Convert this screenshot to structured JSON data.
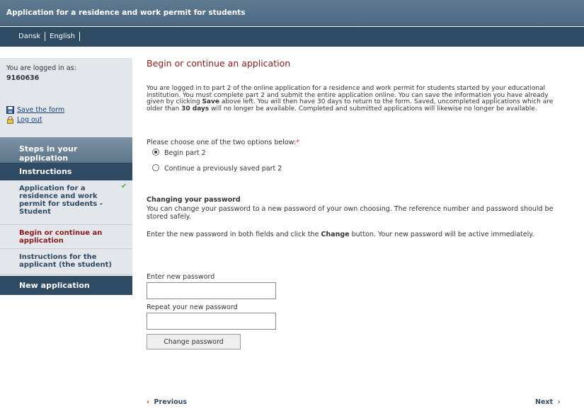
{
  "header": {
    "title": "Application for a residence and work permit for students"
  },
  "languages": [
    "Dansk",
    "English"
  ],
  "sidebar": {
    "logged_in_label": "You are logged in as:",
    "user_id": "9160636",
    "save_form": "Save the form",
    "log_out": "Log out",
    "steps_heading": "Steps in your application",
    "instructions_heading": "Instructions",
    "steps": [
      {
        "label": "Application for a residence and work permit for students - Student",
        "completed": true
      },
      {
        "label": "Begin or continue an application",
        "active": true
      },
      {
        "label": "Instructions for the applicant (the student)"
      }
    ],
    "new_application": "New application"
  },
  "main": {
    "title": "Begin or continue an application",
    "intro_part1": "You are logged in to part 2 of the online application for a residence and work permit for students started by your educational institution. You must complete part 2 and submit the entire application online. You can save the information you have already given by clicking ",
    "intro_bold1": "Save",
    "intro_part2": " above left. You will then have 30 days to return to the form. Saved, uncompleted applications which are older than ",
    "intro_bold2": "30 days",
    "intro_part3": " will no longer be available. Completed and submitted applications will likewise no longer be available.",
    "choose_label": "Please choose one of the two options below:",
    "required_mark": "*",
    "options": [
      {
        "label": "Begin part 2",
        "selected": true
      },
      {
        "label": "Continue a previously saved part 2",
        "selected": false
      }
    ],
    "password_title": "Changing your password",
    "password_text": "You can change your password to a new password of your own choosing. The reference number and password should be stored safely.",
    "password_instr_part1": "Enter the new password in both fields and click the ",
    "password_instr_bold": "Change",
    "password_instr_part2": " button. Your new password will be active immediately.",
    "new_password_label": "Enter new password",
    "new_password_value": "",
    "repeat_password_label": "Repeat your new password",
    "repeat_password_value": "",
    "change_button": "Change password",
    "previous": "Previous",
    "next": "Next"
  },
  "colors": {
    "accent_red": "#8b1a1a",
    "nav_dark": "#2f4a63",
    "check_green": "#5aa832"
  }
}
